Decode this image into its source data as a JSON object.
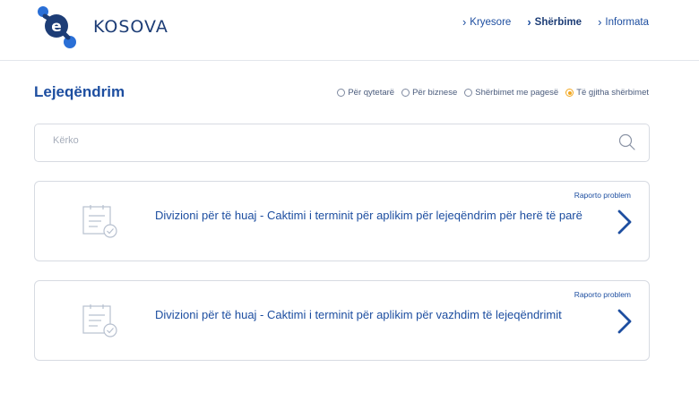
{
  "header": {
    "logo_text": "KOSOVA",
    "nav": [
      {
        "label": "Kryesore"
      },
      {
        "label": "Shërbime"
      },
      {
        "label": "Informata"
      }
    ]
  },
  "page": {
    "title": "Lejeqëndrim"
  },
  "filters": [
    {
      "label": "Për qytetarë",
      "checked": false
    },
    {
      "label": "Për biznese",
      "checked": false
    },
    {
      "label": "Shërbimet me pagesë",
      "checked": false
    },
    {
      "label": "Të gjitha shërbimet",
      "checked": true
    }
  ],
  "search": {
    "placeholder": "Kërko",
    "value": ""
  },
  "services": [
    {
      "title": "Divizioni për të huaj - Caktimi i terminit për aplikim për lejeqëndrim për herë të parë",
      "report_label": "Raporto problem"
    },
    {
      "title": "Divizioni për të huaj - Caktimi i terminit për aplikim për vazhdim të lejeqëndrimit",
      "report_label": "Raporto problem"
    }
  ],
  "colors": {
    "brand_blue": "#1d4ea0",
    "brand_dark": "#1d3d76",
    "accent_orange": "#f2a71e"
  }
}
